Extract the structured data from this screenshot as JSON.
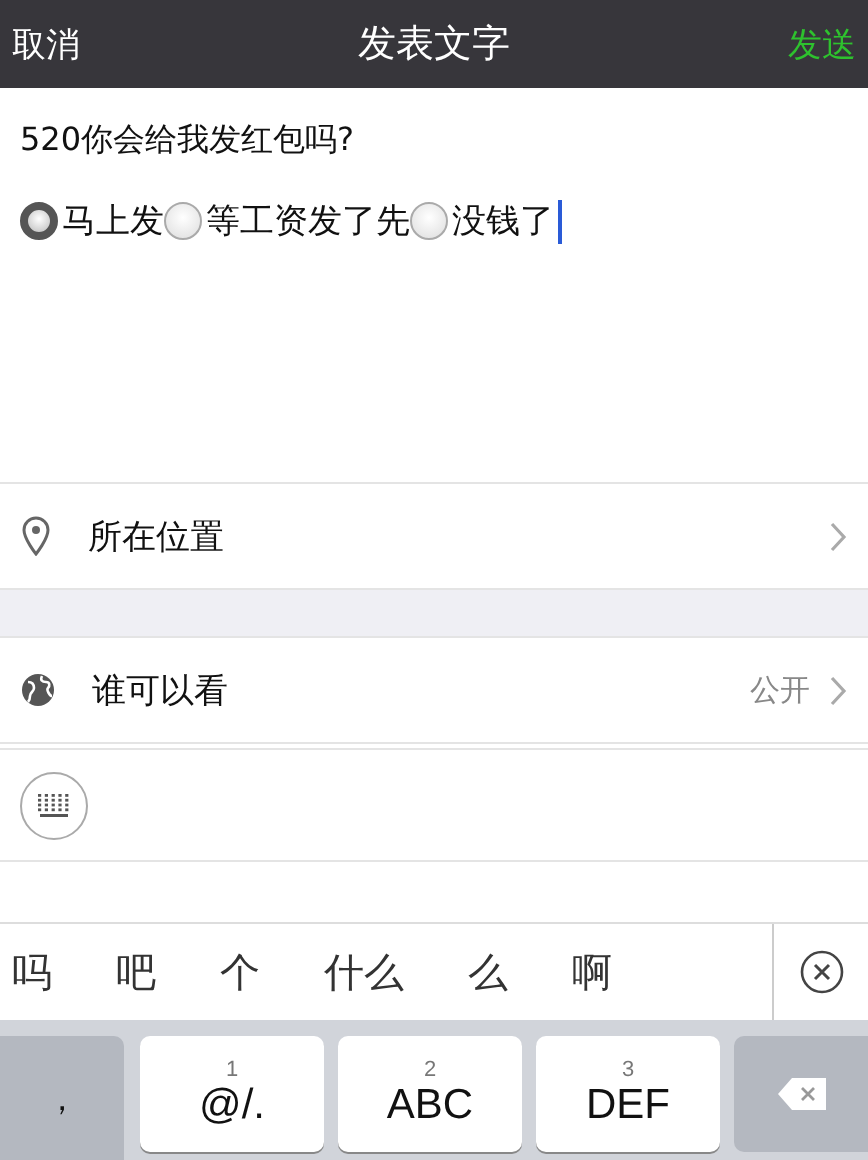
{
  "nav": {
    "cancel": "取消",
    "title": "发表文字",
    "send": "发送"
  },
  "compose": {
    "question": "520你会给我发红包吗?",
    "options": [
      {
        "label": "马上发",
        "selected": true
      },
      {
        "label": "等工资发了先",
        "selected": false
      },
      {
        "label": "没钱了",
        "selected": false
      }
    ]
  },
  "location": {
    "label": "所在位置"
  },
  "visibility": {
    "label": "谁可以看",
    "value": "公开"
  },
  "candidates": [
    "吗",
    "吧",
    "个",
    "什么",
    "么",
    "啊"
  ],
  "keyboard": {
    "punct": "，",
    "keys": [
      {
        "digit": "1",
        "label": "@/."
      },
      {
        "digit": "2",
        "label": "ABC"
      },
      {
        "digit": "3",
        "label": "DEF"
      }
    ]
  }
}
